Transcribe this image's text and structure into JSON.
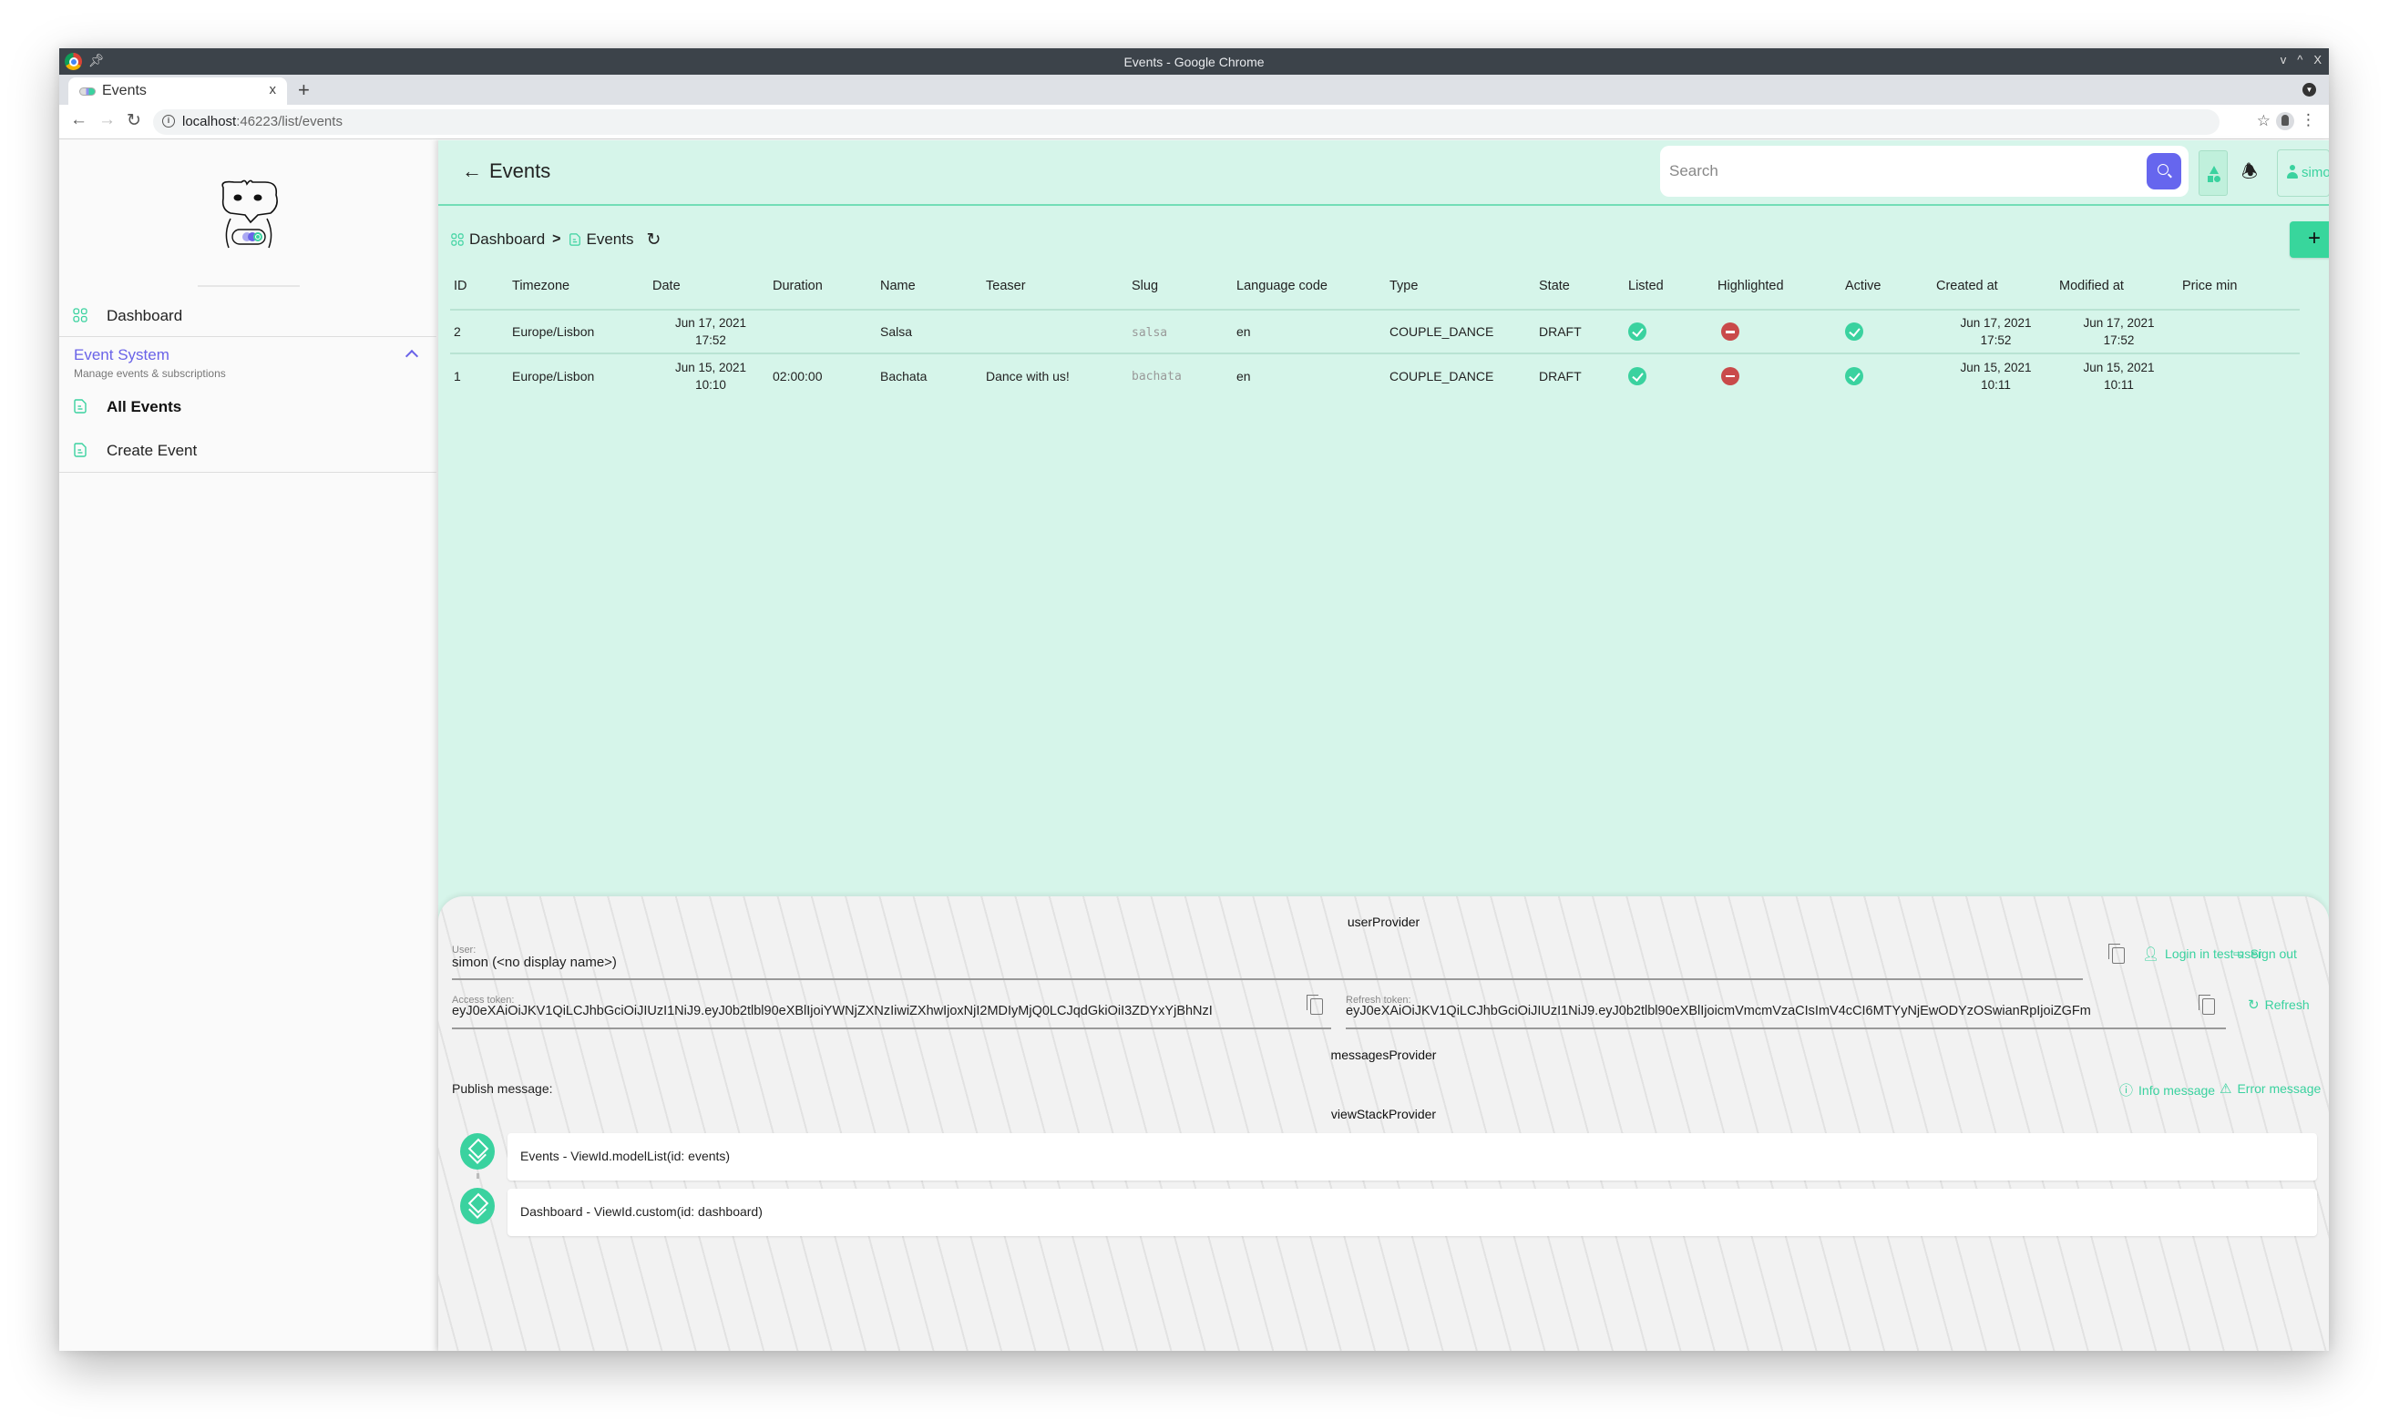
{
  "browser": {
    "window_title": "Events - Google Chrome",
    "tab_title": "Events",
    "tab_close": "x",
    "new_tab": "+",
    "url_host": "localhost",
    "url_rest": ":46223/list/events",
    "controls": [
      "v",
      "^",
      "X"
    ]
  },
  "sidebar": {
    "items": [
      {
        "label": "Dashboard",
        "icon": "grid-icon"
      }
    ],
    "group": {
      "title": "Event System",
      "subtitle": "Manage events & subscriptions",
      "expanded": true,
      "items": [
        {
          "label": "All Events",
          "icon": "document-icon",
          "active": true
        },
        {
          "label": "Create Event",
          "icon": "document-icon",
          "active": false
        }
      ]
    }
  },
  "header": {
    "title": "Events",
    "search_placeholder": "Search",
    "search_value": "",
    "user_name": "simon"
  },
  "breadcrumb": {
    "items": [
      {
        "label": "Dashboard",
        "icon": "grid-icon"
      },
      {
        "label": "Events",
        "icon": "document-icon"
      }
    ],
    "separator": ">"
  },
  "toolbar": {
    "add_label": "Add"
  },
  "table": {
    "columns": [
      "ID",
      "Timezone",
      "Date",
      "Duration",
      "Name",
      "Teaser",
      "Slug",
      "Language code",
      "Type",
      "State",
      "Listed",
      "Highlighted",
      "Active",
      "Created at",
      "Modified at",
      "Price min"
    ],
    "rows": [
      {
        "id": "2",
        "timezone": "Europe/Lisbon",
        "date": "Jun 17, 2021",
        "date_time": "17:52",
        "duration": "",
        "name": "Salsa",
        "teaser": "",
        "slug": "salsa",
        "language_code": "en",
        "type": "COUPLE_DANCE",
        "state": "DRAFT",
        "listed": true,
        "highlighted": false,
        "active": true,
        "created_date": "Jun 17, 2021",
        "created_time": "17:52",
        "modified_date": "Jun 17, 2021",
        "modified_time": "17:52",
        "price_min": ""
      },
      {
        "id": "1",
        "timezone": "Europe/Lisbon",
        "date": "Jun 15, 2021",
        "date_time": "10:10",
        "duration": "02:00:00",
        "name": "Bachata",
        "teaser": "Dance with us!",
        "slug": "bachata",
        "language_code": "en",
        "type": "COUPLE_DANCE",
        "state": "DRAFT",
        "listed": true,
        "highlighted": false,
        "active": true,
        "created_date": "Jun 15, 2021",
        "created_time": "10:11",
        "modified_date": "Jun 15, 2021",
        "modified_time": "10:11",
        "price_min": ""
      }
    ]
  },
  "debug": {
    "user_provider": {
      "title": "userProvider",
      "user_label": "User:",
      "user_value": "simon (<no display name>)",
      "access_label": "Access token:",
      "access_value": "eyJ0eXAiOiJKV1QiLCJhbGciOiJIUzI1NiJ9.eyJ0b2tlbl90eXBlIjoiYWNjZXNzIiwiZXhwIjoxNjI2MDIyMjQ0LCJqdGkiOiI3ZDYxYjBhNzI",
      "refresh_label": "Refresh token:",
      "refresh_value": "eyJ0eXAiOiJKV1QiLCJhbGciOiJIUzI1NiJ9.eyJ0b2tlbl90eXBlIjoicmVmcmVzaCIsImV4cCI6MTYyNjEwODYzOSwianRpIjoiZGFm",
      "login_test_user": "Login in test user",
      "sign_out": "Sign out",
      "refresh": "Refresh"
    },
    "messages_provider": {
      "title": "messagesProvider",
      "publish_label": "Publish message:",
      "info_message": "Info message",
      "error_message": "Error message"
    },
    "view_stack_provider": {
      "title": "viewStackProvider",
      "views": [
        "Events - ViewId.modelList(id: events)",
        "Dashboard - ViewId.custom(id: dashboard)"
      ]
    }
  },
  "colors": {
    "accent_green": "#3ad29f",
    "accent_purple": "#6a63e8",
    "main_bg": "#d6f5ea",
    "error_red": "#c94a4a",
    "search_button": "#6666ee"
  }
}
